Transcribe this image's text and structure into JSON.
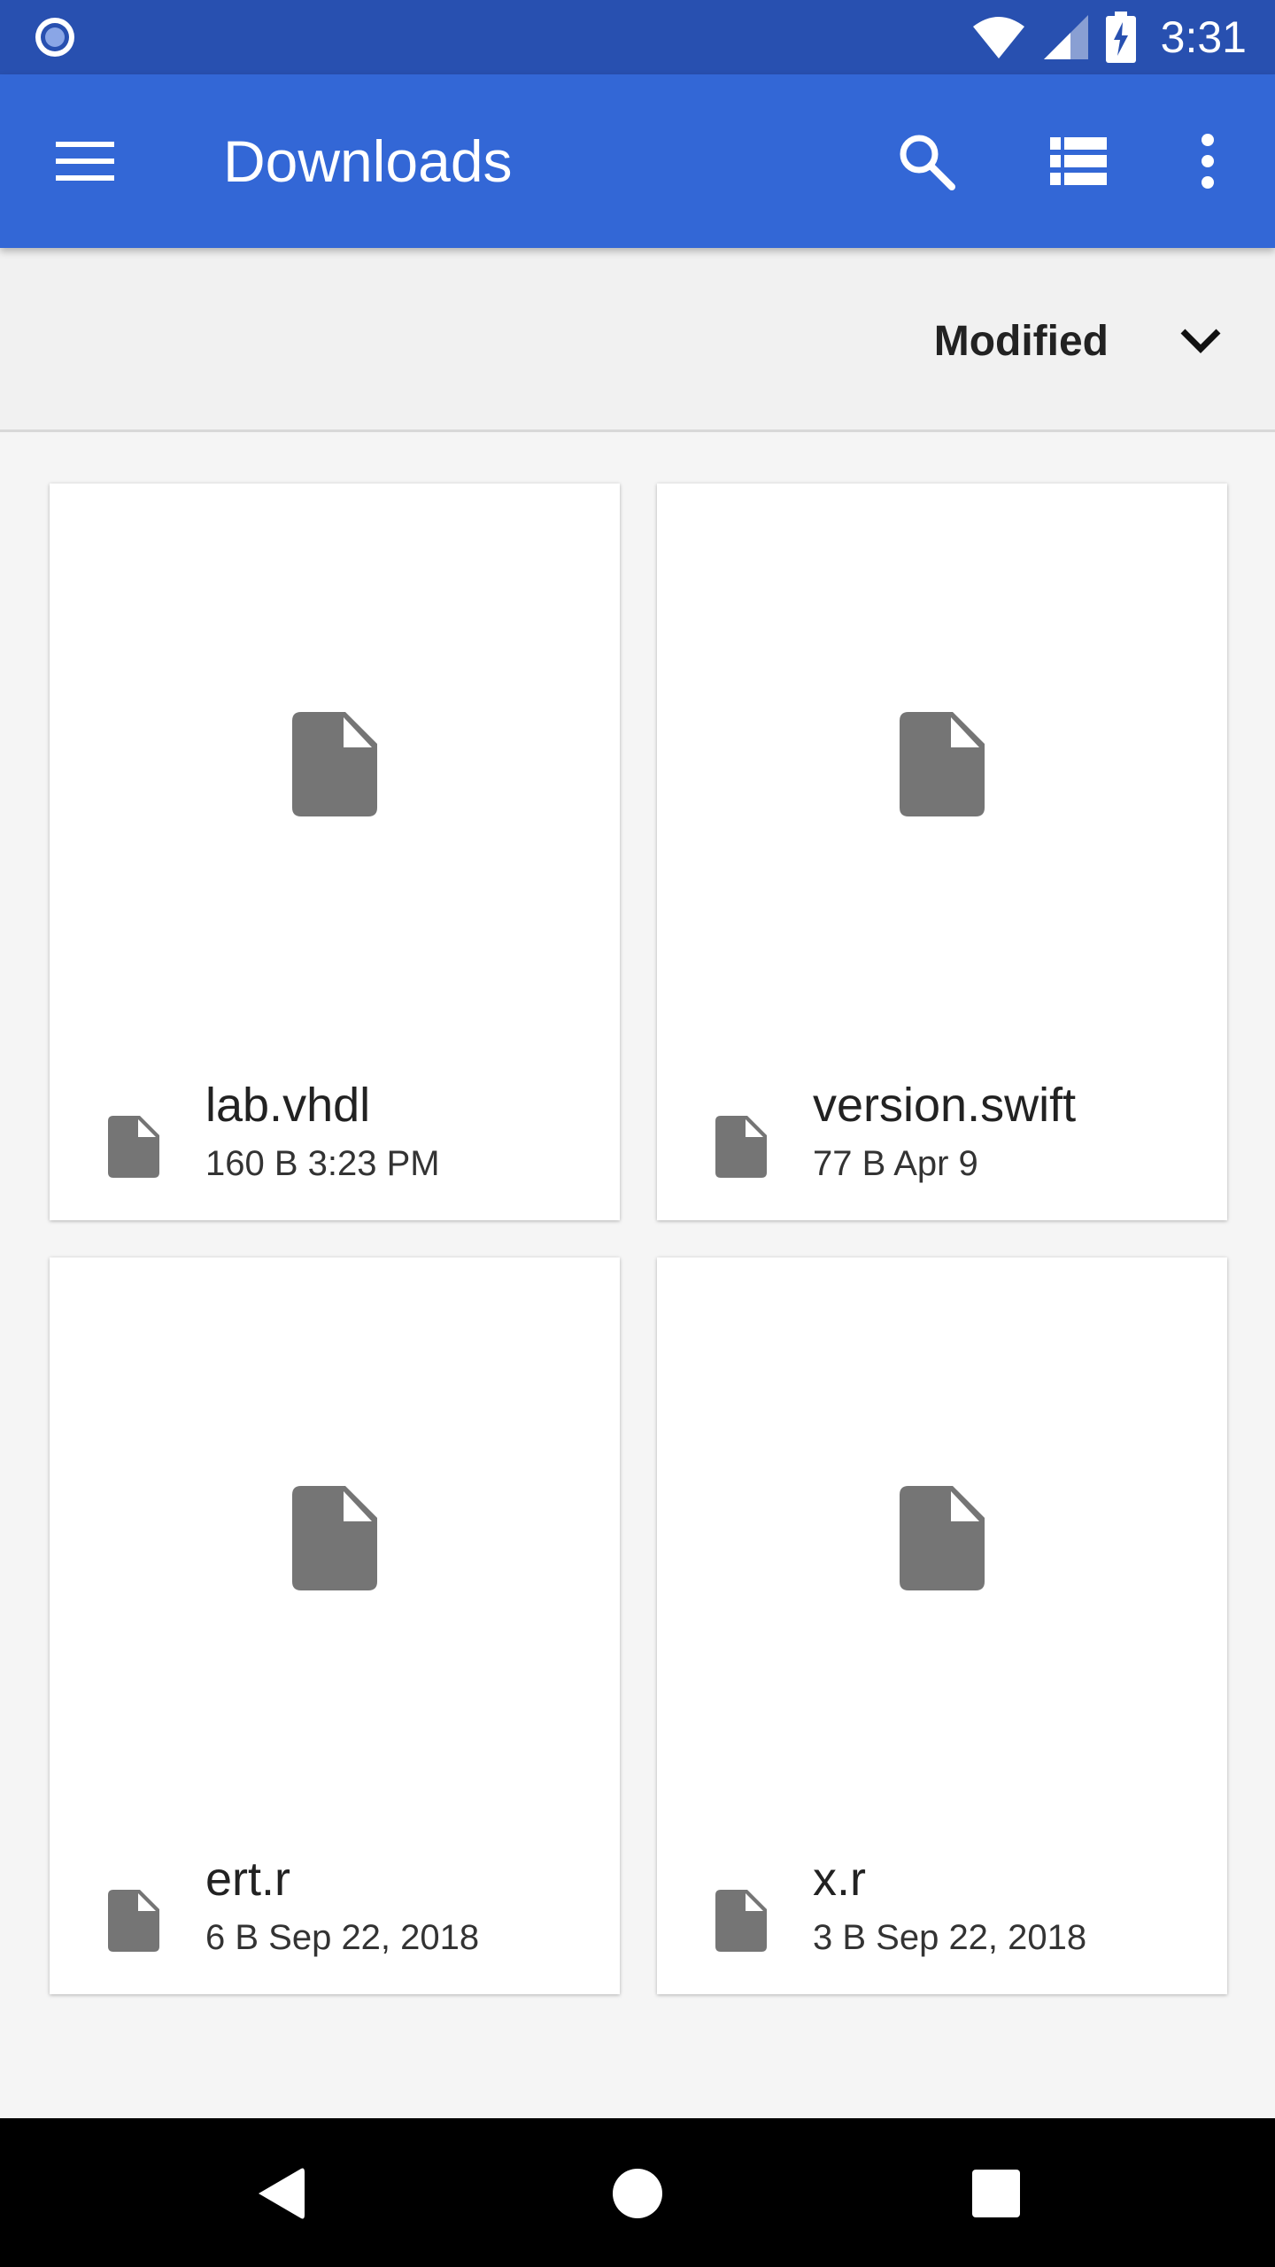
{
  "status_bar": {
    "time": "3:31",
    "icons": [
      "notification-dot-icon",
      "wifi-icon",
      "signal-icon",
      "battery-charging-icon"
    ]
  },
  "app_bar": {
    "title": "Downloads",
    "icons": [
      "menu-icon",
      "search-icon",
      "list-view-icon",
      "more-vert-icon"
    ],
    "color": "#3367d6"
  },
  "sort_bar": {
    "label": "Modified",
    "icon": "chevron-down-icon"
  },
  "files": [
    {
      "name": "lab.vhdl",
      "meta": "160 B 3:23 PM"
    },
    {
      "name": "version.swift",
      "meta": "77 B Apr 9"
    },
    {
      "name": "ert.r",
      "meta": "6 B Sep 22, 2018"
    },
    {
      "name": "x.r",
      "meta": "3 B Sep 22, 2018"
    }
  ],
  "nav_bar": {
    "icons": [
      "back-icon",
      "home-icon",
      "recents-icon"
    ]
  }
}
